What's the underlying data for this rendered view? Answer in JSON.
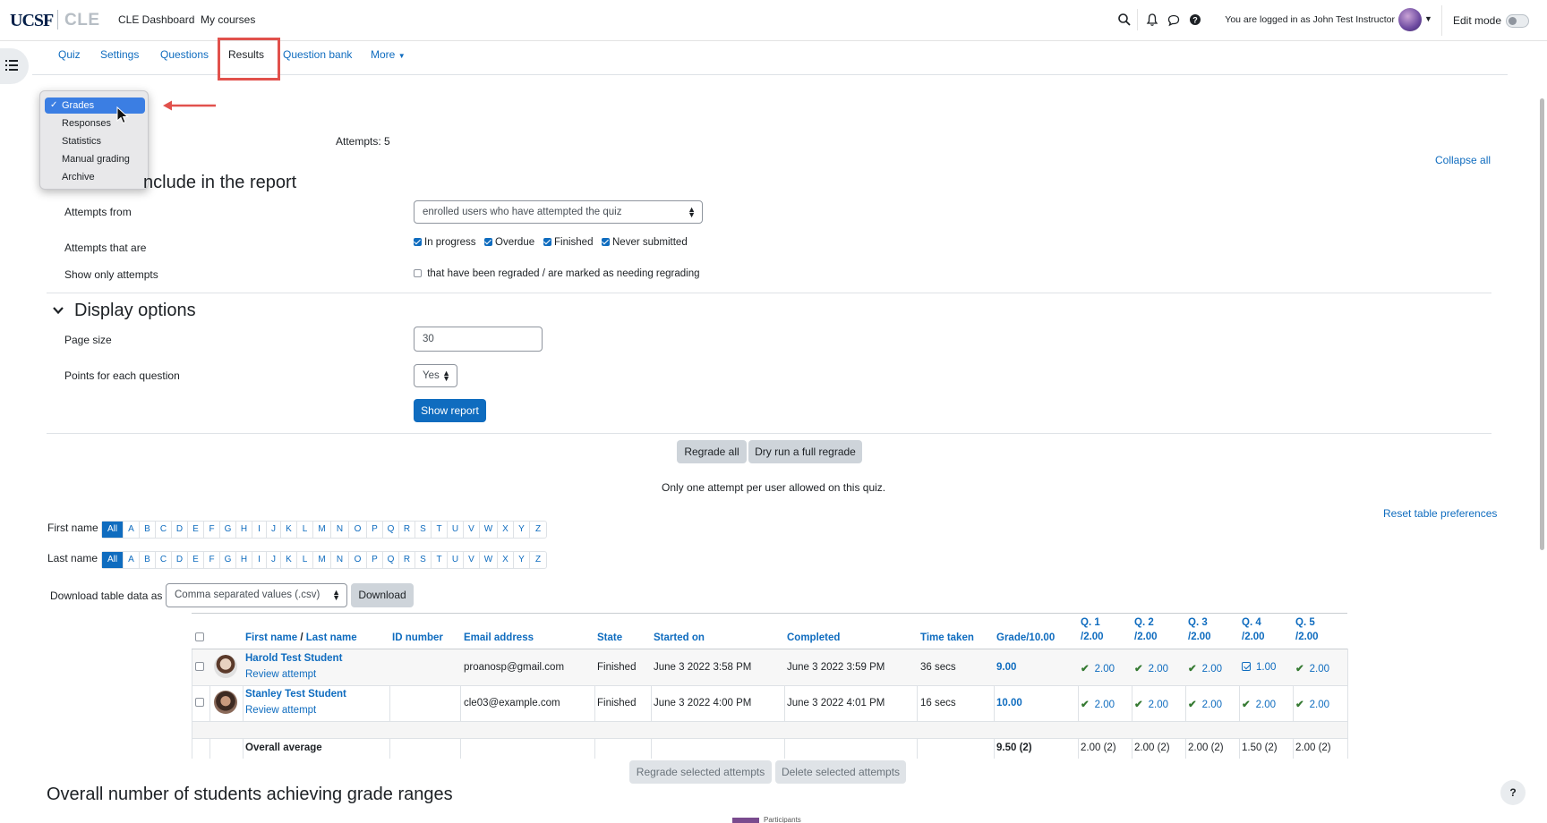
{
  "brand": {
    "logo": "UCSF",
    "site": "CLE"
  },
  "topnav": {
    "dashboard": "CLE Dashboard",
    "my_courses": "My courses",
    "login_text": "You are logged in as John Test Instructor",
    "edit_mode": "Edit mode"
  },
  "secondary_nav": {
    "tabs": [
      "Quiz",
      "Settings",
      "Questions",
      "Results",
      "Question bank",
      "More"
    ],
    "active": "Results"
  },
  "report_menu": {
    "items": [
      "Grades",
      "Responses",
      "Statistics",
      "Manual grading",
      "Archive"
    ],
    "selected": "Grades"
  },
  "attempts_summary": "Attempts: 5",
  "collapse_all": "Collapse all",
  "include_section": {
    "heading": "nclude in the report",
    "attempts_from_label": "Attempts from",
    "attempts_from_value": "enrolled users who have attempted the quiz",
    "attempts_that_are_label": "Attempts that are",
    "states": [
      {
        "label": "In progress",
        "checked": true
      },
      {
        "label": "Overdue",
        "checked": true
      },
      {
        "label": "Finished",
        "checked": true
      },
      {
        "label": "Never submitted",
        "checked": true
      }
    ],
    "show_only_label": "Show only attempts",
    "regraded_label": "that have been regraded / are marked as needing regrading"
  },
  "display_section": {
    "heading": "Display options",
    "page_size_label": "Page size",
    "page_size_value": "30",
    "points_label": "Points for each question",
    "points_value": "Yes",
    "show_report": "Show report"
  },
  "regrade": {
    "regrade_all": "Regrade all",
    "dry_run": "Dry run a full regrade"
  },
  "notice": "Only one attempt per user allowed on this quiz.",
  "reset_prefs": "Reset table preferences",
  "initials": {
    "first_label": "First name",
    "last_label": "Last name",
    "letters": [
      "All",
      "A",
      "B",
      "C",
      "D",
      "E",
      "F",
      "G",
      "H",
      "I",
      "J",
      "K",
      "L",
      "M",
      "N",
      "O",
      "P",
      "Q",
      "R",
      "S",
      "T",
      "U",
      "V",
      "W",
      "X",
      "Y",
      "Z"
    ]
  },
  "download": {
    "label": "Download table data as",
    "format": "Comma separated values (.csv)",
    "button": "Download"
  },
  "table": {
    "headers": {
      "first_name": "First name",
      "sep": " / ",
      "last_name": "Last name",
      "id_number": "ID number",
      "email": "Email address",
      "state": "State",
      "started": "Started on",
      "completed": "Completed",
      "time_taken": "Time taken",
      "grade": "Grade/10.00",
      "questions": [
        {
          "q": "Q. 1",
          "max": "/2.00"
        },
        {
          "q": "Q. 2",
          "max": "/2.00"
        },
        {
          "q": "Q. 3",
          "max": "/2.00"
        },
        {
          "q": "Q. 4",
          "max": "/2.00"
        },
        {
          "q": "Q. 5",
          "max": "/2.00"
        }
      ]
    },
    "rows": [
      {
        "name": "Harold Test Student",
        "review": "Review attempt",
        "email": "proanosp@gmail.com",
        "state": "Finished",
        "started": "June 3 2022 3:58 PM",
        "completed": "June 3 2022 3:59 PM",
        "time_taken": "36 secs",
        "grade": "9.00",
        "q": [
          "2.00",
          "2.00",
          "2.00",
          "1.00",
          "2.00"
        ]
      },
      {
        "name": "Stanley Test Student",
        "review": "Review attempt",
        "email": "cle03@example.com",
        "state": "Finished",
        "started": "June 3 2022 4:00 PM",
        "completed": "June 3 2022 4:01 PM",
        "time_taken": "16 secs",
        "grade": "10.00",
        "q": [
          "2.00",
          "2.00",
          "2.00",
          "2.00",
          "2.00"
        ]
      }
    ],
    "average": {
      "label": "Overall average",
      "grade": "9.50 (2)",
      "q": [
        "2.00 (2)",
        "2.00 (2)",
        "2.00 (2)",
        "1.50 (2)",
        "2.00 (2)"
      ]
    }
  },
  "bulk_actions": {
    "regrade_selected": "Regrade selected attempts",
    "delete_selected": "Delete selected attempts"
  },
  "bottom_heading": "Overall number of students achieving grade ranges",
  "legend": "Participants",
  "help": "?"
}
